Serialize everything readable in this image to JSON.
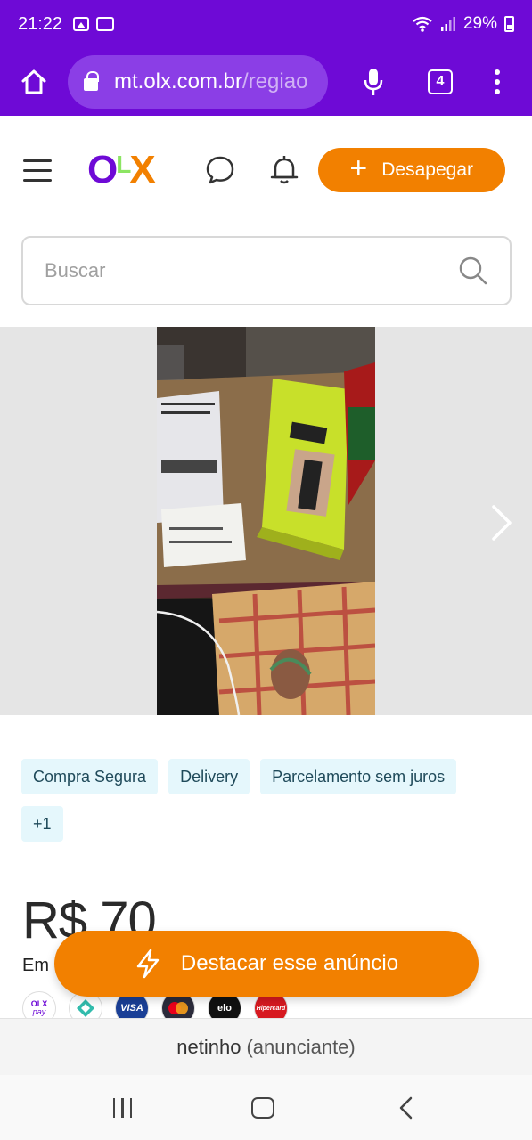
{
  "status_bar": {
    "time": "21:22",
    "battery": "29%"
  },
  "browser": {
    "url_domain": "mt.olx.com.br",
    "url_rest": "/regiao",
    "tab_count": "4"
  },
  "header": {
    "logo": {
      "o": "O",
      "l": "L",
      "x": "X"
    },
    "post_button_label": "Desapegar"
  },
  "search": {
    "placeholder": "Buscar"
  },
  "badges": [
    "Compra Segura",
    "Delivery",
    "Parcelamento sem juros",
    "+1"
  ],
  "listing": {
    "price": "R$ 70",
    "installments_prefix": "Em"
  },
  "payments": {
    "olx": "OLX",
    "pay": "pay",
    "visa": "VISA",
    "elo": "elo",
    "hipercard": "Hipercard"
  },
  "highlight_button_label": "Destacar esse anúncio",
  "advertiser": {
    "name": "netinho",
    "role": "(anunciante)"
  },
  "colors": {
    "brand_purple": "#6e0ad6",
    "brand_orange": "#f28000",
    "badge_bg": "#e5f7fc"
  }
}
